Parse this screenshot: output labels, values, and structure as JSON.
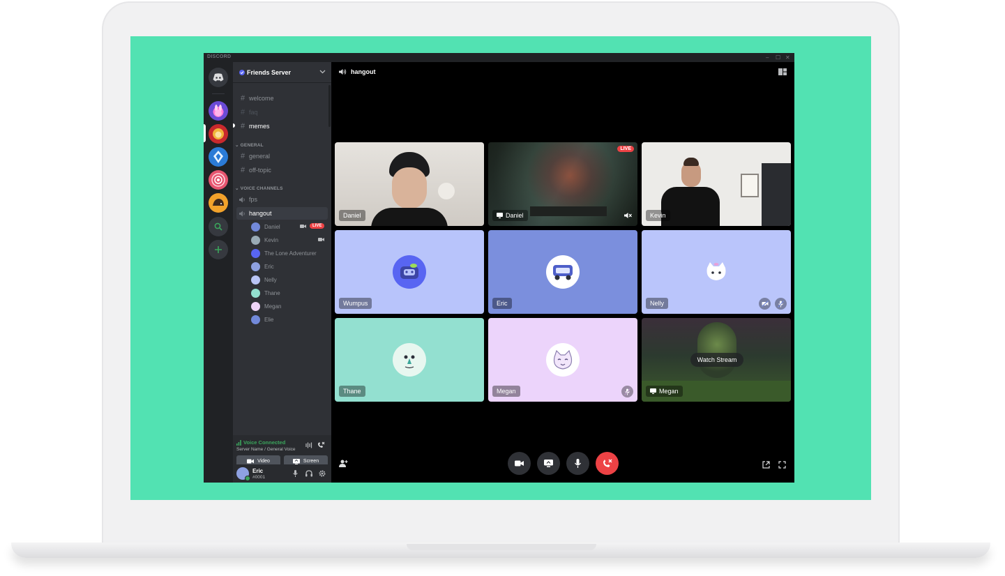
{
  "window": {
    "brand": "DISCORD",
    "minimize": "–",
    "maximize": "☐",
    "close": "✕"
  },
  "server": {
    "name": "Friends Server"
  },
  "text_channels": [
    {
      "name": "welcome",
      "state": "normal"
    },
    {
      "name": "faq",
      "state": "muted"
    },
    {
      "name": "memes",
      "state": "unread"
    }
  ],
  "categories": {
    "general": "GENERAL",
    "voice": "VOICE CHANNELS"
  },
  "general_channels": [
    {
      "name": "general"
    },
    {
      "name": "off-topic"
    }
  ],
  "voice_channels": [
    {
      "name": "fps"
    },
    {
      "name": "hangout"
    }
  ],
  "voice_users": [
    {
      "name": "Daniel",
      "camera": true,
      "live": "LIVE",
      "color": "#7289da"
    },
    {
      "name": "Kevin",
      "camera": true,
      "color": "#99aab5"
    },
    {
      "name": "The Lone Adventurer",
      "color": "#5865f2"
    },
    {
      "name": "Eric",
      "color": "#8ea1e1"
    },
    {
      "name": "Nelly",
      "color": "#b9c4f5"
    },
    {
      "name": "Thane",
      "color": "#93e0d0"
    },
    {
      "name": "Megan",
      "color": "#eed3f7"
    },
    {
      "name": "Elie",
      "color": "#7289da"
    }
  ],
  "voice_connected": {
    "status": "Voice Connected",
    "location": "Server Name / General Voice",
    "video_label": "Video",
    "screen_label": "Screen"
  },
  "user": {
    "name": "Eric",
    "tag": "#0001"
  },
  "call": {
    "channel": "hangout"
  },
  "tiles": [
    {
      "name": "Daniel",
      "kind": "camera",
      "bg": "#d9d6d1"
    },
    {
      "name": "Daniel",
      "kind": "stream",
      "live": "LIVE",
      "bg": "#3a4a3c"
    },
    {
      "name": "Kevin",
      "kind": "camera",
      "bg": "#e8e8e6"
    },
    {
      "name": "Wumpus",
      "kind": "avatar",
      "bg": "#b8c4fb"
    },
    {
      "name": "Eric",
      "kind": "avatar",
      "bg": "#7b8fdd"
    },
    {
      "name": "Nelly",
      "kind": "avatar",
      "bg": "#bac5fb"
    },
    {
      "name": "Thane",
      "kind": "avatar",
      "bg": "#93e0d0"
    },
    {
      "name": "Megan",
      "kind": "avatar",
      "bg": "#ecd4fb"
    },
    {
      "name": "Megan",
      "kind": "stream",
      "watch_label": "Watch Stream",
      "bg": "#2c3a2f"
    }
  ],
  "colors": {
    "brand_green": "#52e2b2",
    "danger": "#ed4245",
    "online": "#3ba55c",
    "blurple": "#5865f2"
  }
}
